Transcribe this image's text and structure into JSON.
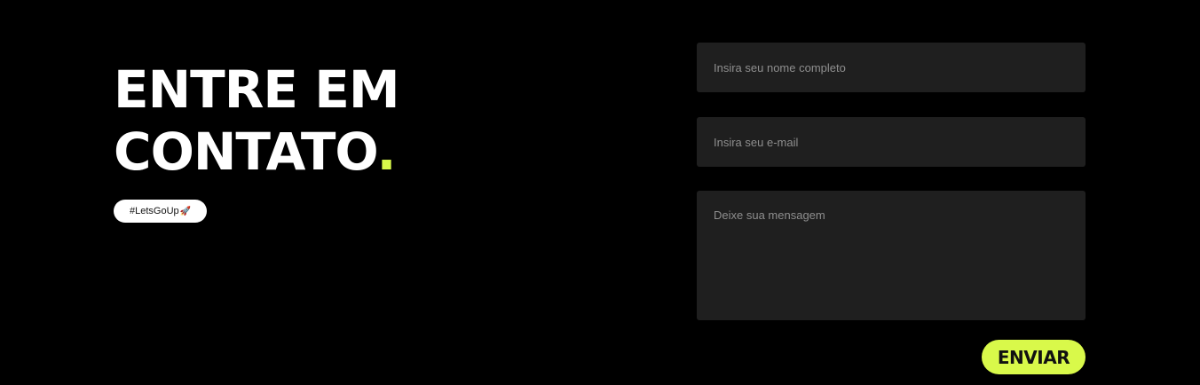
{
  "contact": {
    "title_line1": "ENTRE EM",
    "title_line2": "CONTATO",
    "title_dot": ".",
    "tag_text": "#LetsGoUp",
    "tag_icon": "🚀"
  },
  "form": {
    "name_placeholder": "Insira seu nome completo",
    "email_placeholder": "Insira seu e-mail",
    "message_placeholder": "Deixe sua mensagem",
    "submit_label": "ENVIAR"
  },
  "colors": {
    "background": "#000000",
    "accent": "#d9f94a",
    "field_background": "#1f1f1f"
  }
}
